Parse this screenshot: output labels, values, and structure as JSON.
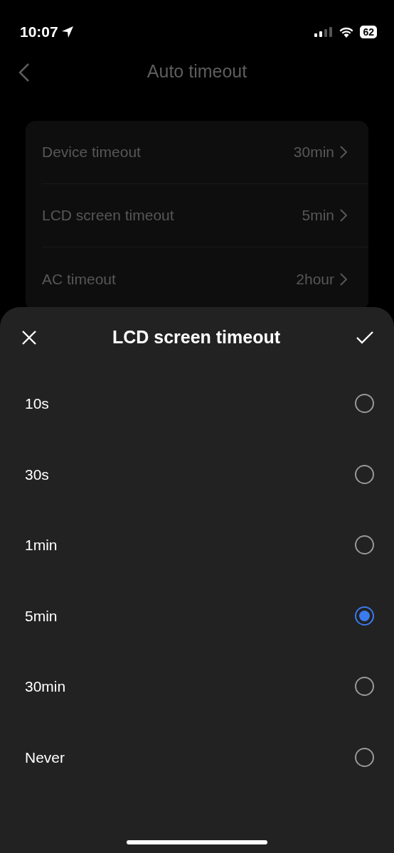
{
  "status_bar": {
    "time": "10:07",
    "battery": "62"
  },
  "header": {
    "title": "Auto timeout"
  },
  "settings": [
    {
      "label": "Device timeout",
      "value": "30min"
    },
    {
      "label": "LCD screen timeout",
      "value": "5min"
    },
    {
      "label": "AC timeout",
      "value": "2hour"
    }
  ],
  "sheet": {
    "title": "LCD screen timeout",
    "options": [
      {
        "label": "10s",
        "selected": false
      },
      {
        "label": "30s",
        "selected": false
      },
      {
        "label": "1min",
        "selected": false
      },
      {
        "label": "5min",
        "selected": true
      },
      {
        "label": "30min",
        "selected": false
      },
      {
        "label": "Never",
        "selected": false
      }
    ]
  }
}
